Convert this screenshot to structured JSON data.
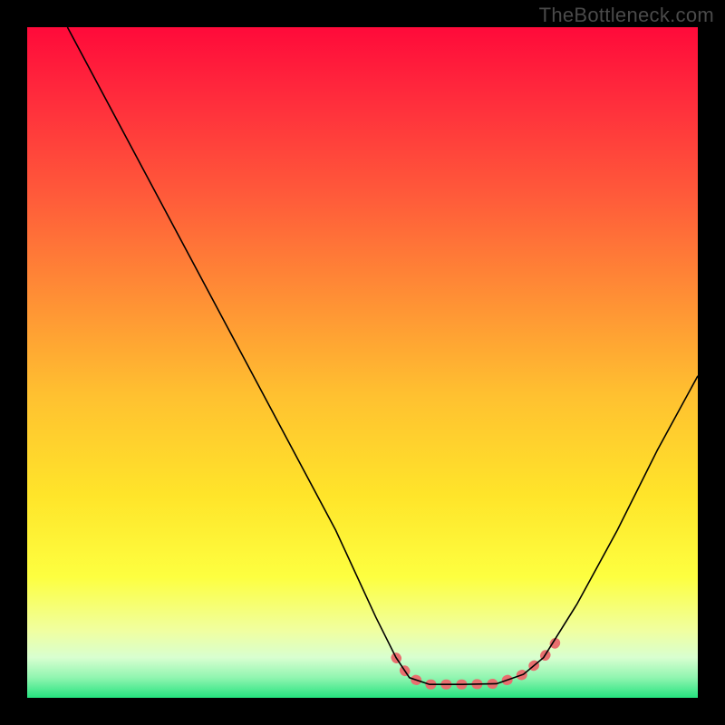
{
  "watermark": "TheBottleneck.com",
  "chart_data": {
    "type": "line",
    "title": "",
    "xlabel": "",
    "ylabel": "",
    "xlim": [
      0,
      100
    ],
    "ylim": [
      0,
      100
    ],
    "background_gradient": {
      "stops": [
        {
          "offset": 0.0,
          "color": "#ff0a3a"
        },
        {
          "offset": 0.1,
          "color": "#ff2a3c"
        },
        {
          "offset": 0.25,
          "color": "#ff5a3a"
        },
        {
          "offset": 0.4,
          "color": "#ff8e35"
        },
        {
          "offset": 0.55,
          "color": "#ffc130"
        },
        {
          "offset": 0.7,
          "color": "#ffe52a"
        },
        {
          "offset": 0.82,
          "color": "#fdff40"
        },
        {
          "offset": 0.9,
          "color": "#f0ffa0"
        },
        {
          "offset": 0.94,
          "color": "#d8ffd0"
        },
        {
          "offset": 0.97,
          "color": "#90f5b0"
        },
        {
          "offset": 1.0,
          "color": "#25e37f"
        }
      ]
    },
    "series": [
      {
        "name": "bottleneck-curve",
        "color": "#000000",
        "width": 1.6,
        "points": [
          {
            "x": 6.0,
            "y": 100.0
          },
          {
            "x": 14.0,
            "y": 85.0
          },
          {
            "x": 22.0,
            "y": 70.0
          },
          {
            "x": 30.0,
            "y": 55.0
          },
          {
            "x": 38.0,
            "y": 40.0
          },
          {
            "x": 46.0,
            "y": 25.0
          },
          {
            "x": 52.0,
            "y": 12.0
          },
          {
            "x": 55.0,
            "y": 6.0
          },
          {
            "x": 57.0,
            "y": 3.0
          },
          {
            "x": 60.0,
            "y": 2.0
          },
          {
            "x": 65.0,
            "y": 2.0
          },
          {
            "x": 70.0,
            "y": 2.1
          },
          {
            "x": 74.0,
            "y": 3.5
          },
          {
            "x": 77.0,
            "y": 6.0
          },
          {
            "x": 82.0,
            "y": 14.0
          },
          {
            "x": 88.0,
            "y": 25.0
          },
          {
            "x": 94.0,
            "y": 37.0
          },
          {
            "x": 100.0,
            "y": 48.0
          }
        ]
      },
      {
        "name": "highlight-segment",
        "color": "#e86f6f",
        "width": 11,
        "linecap": "round",
        "points": [
          {
            "x": 55.0,
            "y": 6.0
          },
          {
            "x": 57.0,
            "y": 3.0
          },
          {
            "x": 60.0,
            "y": 2.0
          },
          {
            "x": 65.0,
            "y": 2.0
          },
          {
            "x": 70.0,
            "y": 2.1
          },
          {
            "x": 74.0,
            "y": 3.5
          },
          {
            "x": 77.0,
            "y": 6.0
          },
          {
            "x": 79.0,
            "y": 8.5
          }
        ]
      }
    ]
  }
}
